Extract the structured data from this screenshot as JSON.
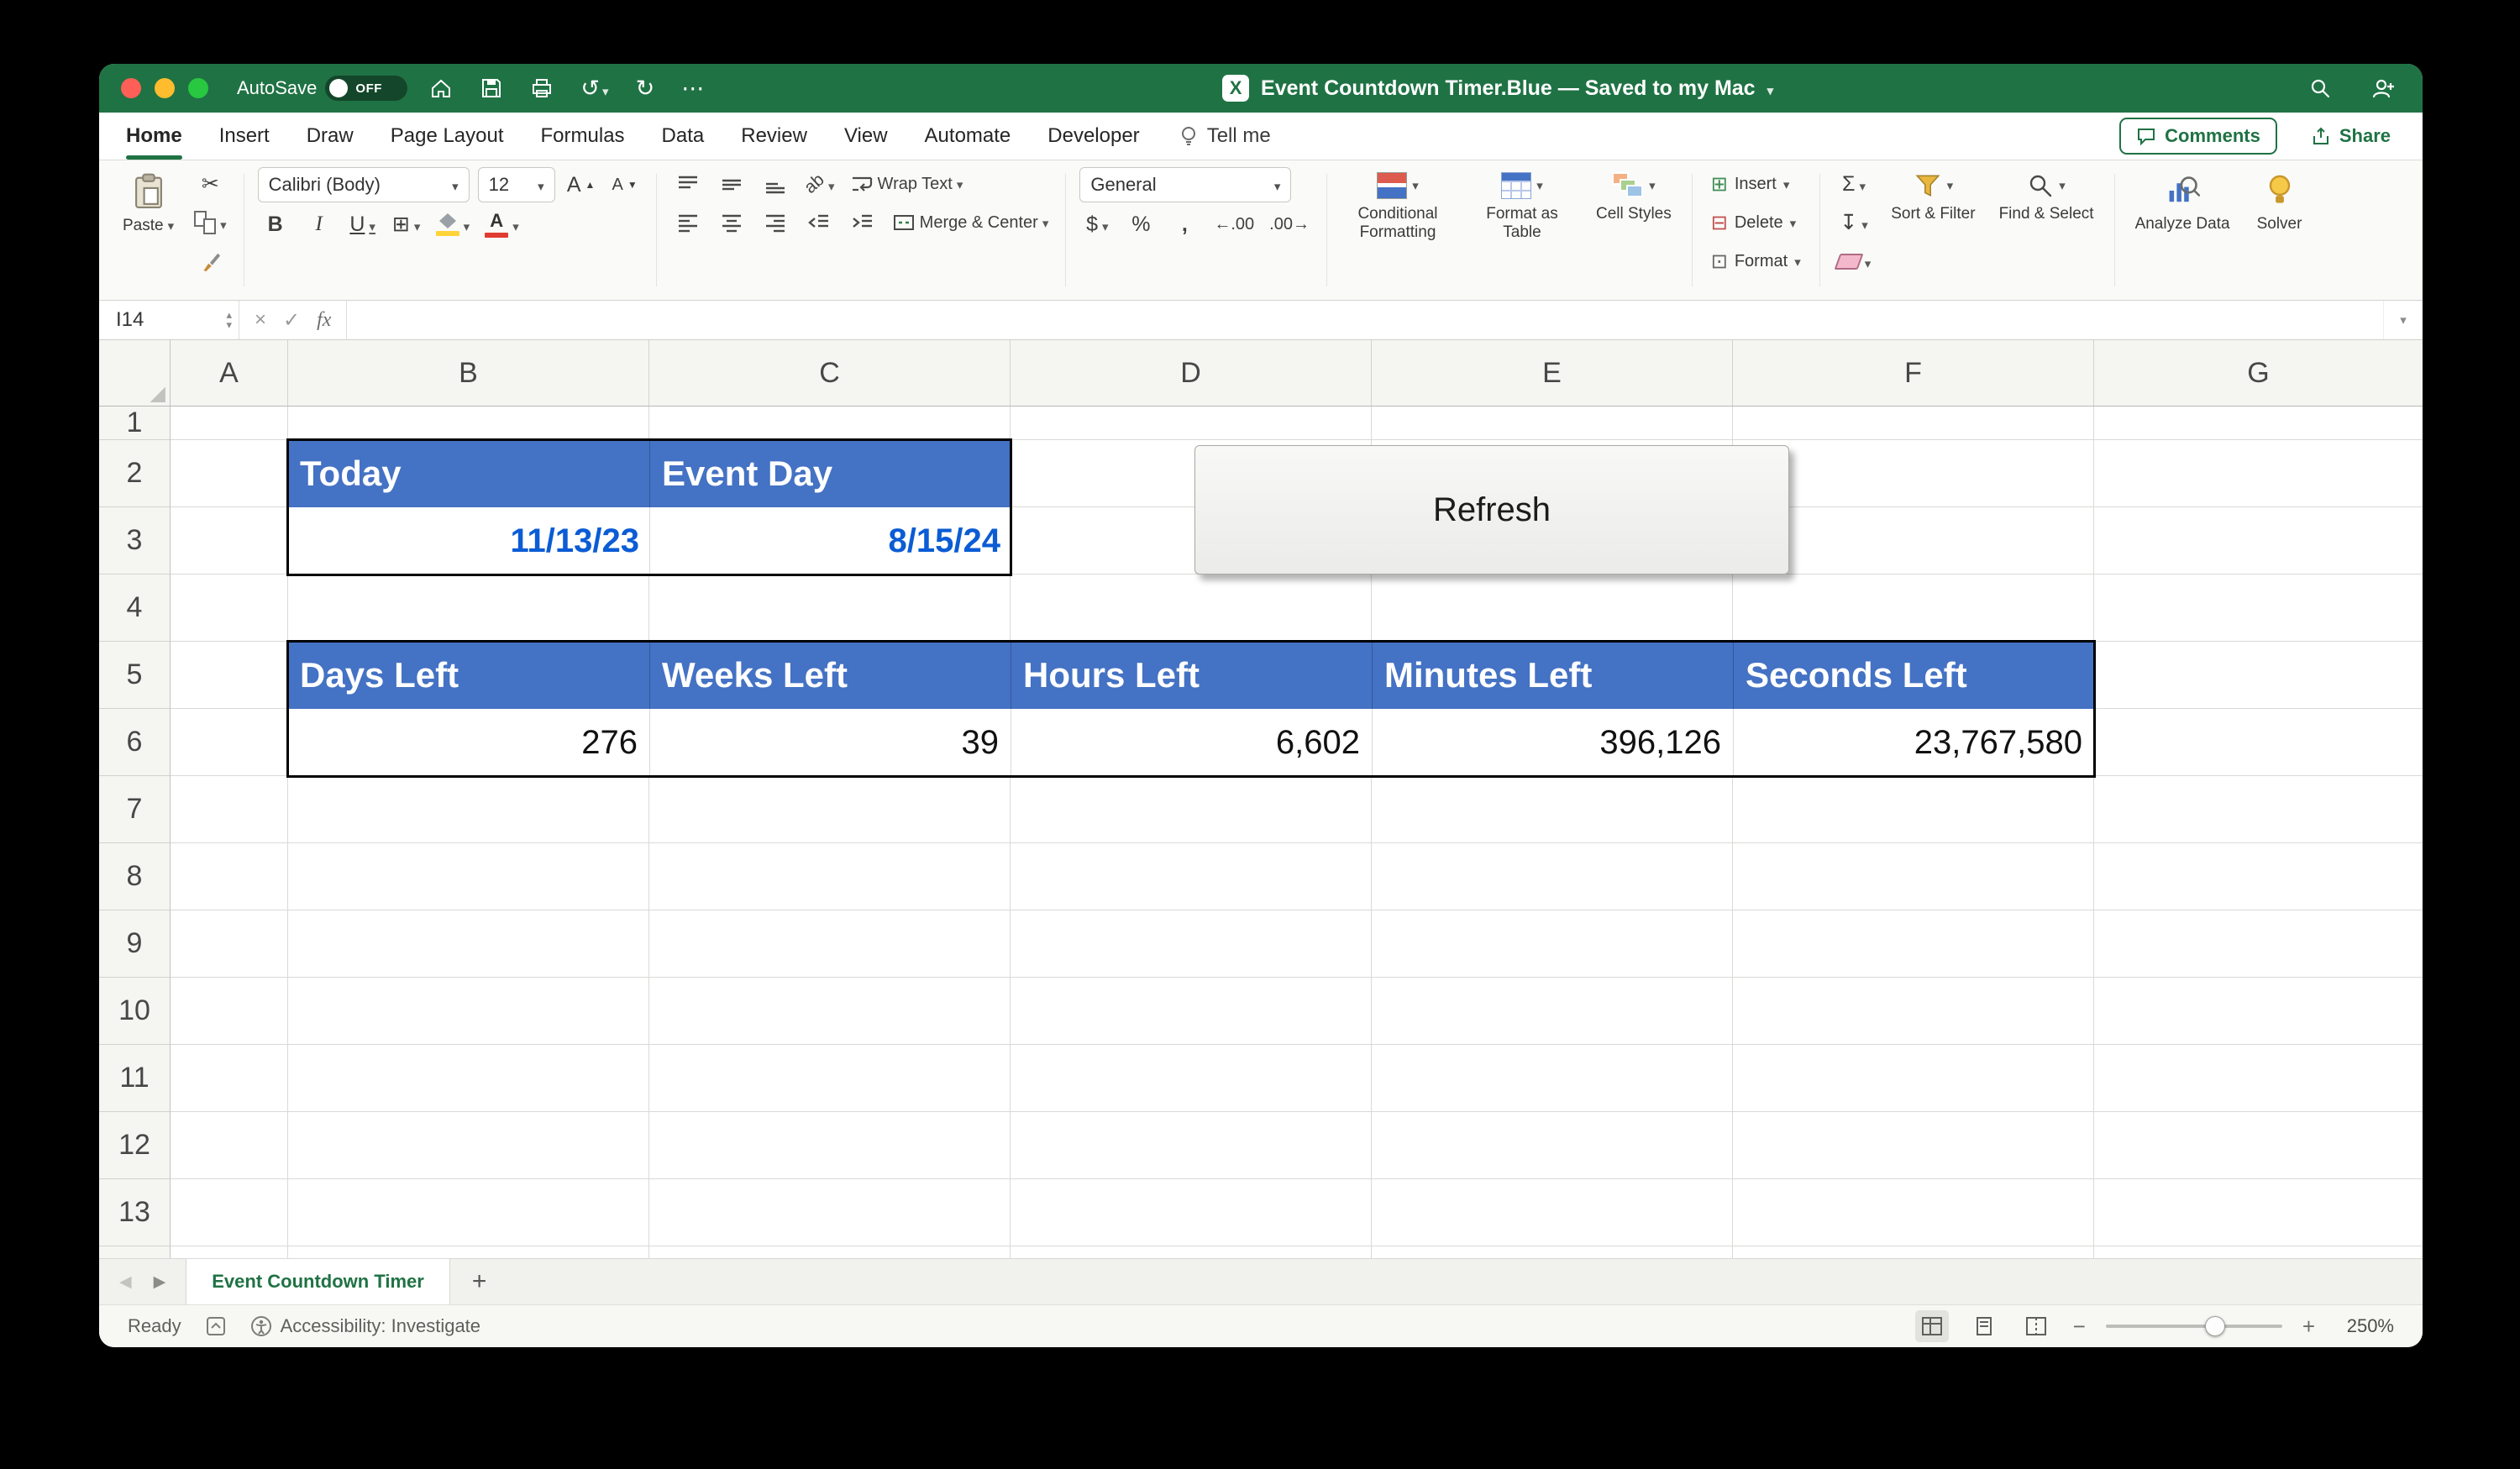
{
  "titlebar": {
    "autosave_label": "AutoSave",
    "autosave_state": "OFF",
    "title": "Event Countdown Timer.Blue — Saved to my Mac"
  },
  "ribbon_tabs": {
    "tabs": [
      "Home",
      "Insert",
      "Draw",
      "Page Layout",
      "Formulas",
      "Data",
      "Review",
      "View",
      "Automate",
      "Developer"
    ],
    "active": "Home",
    "tell_me": "Tell me",
    "comments": "Comments",
    "share": "Share"
  },
  "ribbon": {
    "paste": "Paste",
    "font_name": "Calibri (Body)",
    "font_size": "12",
    "wrap_text": "Wrap Text",
    "merge_center": "Merge & Center",
    "number_format": "General",
    "conditional_formatting": "Conditional Formatting",
    "format_as_table": "Format as Table",
    "cell_styles": "Cell Styles",
    "insert": "Insert",
    "delete": "Delete",
    "format": "Format",
    "sort_filter": "Sort & Filter",
    "find_select": "Find & Select",
    "analyze_data": "Analyze Data",
    "solver": "Solver"
  },
  "formula_bar": {
    "name_box": "I14",
    "formula": ""
  },
  "grid": {
    "columns": [
      "A",
      "B",
      "C",
      "D",
      "E",
      "F",
      "G"
    ],
    "rows": [
      "1",
      "2",
      "3",
      "4",
      "5",
      "6",
      "7",
      "8",
      "9",
      "10",
      "11",
      "12",
      "13"
    ]
  },
  "sheet": {
    "cells": {
      "today_label": "Today",
      "event_day_label": "Event Day",
      "today_date": "11/13/23",
      "event_date": "8/15/24",
      "refresh_label": "Refresh",
      "table_headers": [
        "Days Left",
        "Weeks Left",
        "Hours Left",
        "Minutes Left",
        "Seconds Left"
      ],
      "table_values": [
        "276",
        "39",
        "6,602",
        "396,126",
        "23,767,580"
      ]
    },
    "colors": {
      "header_fill": "#4472C4",
      "header_text": "#FFFFFF",
      "date_text": "#0B5CD5",
      "titlebar_green": "#1F7244"
    }
  },
  "sheet_tabs": {
    "active": "Event Countdown Timer"
  },
  "status_bar": {
    "ready": "Ready",
    "accessibility": "Accessibility: Investigate",
    "zoom": "250%"
  },
  "icons": {
    "undo": "↺",
    "redo": "↻",
    "more": "⋯",
    "cut": "✂",
    "sigma": "Σ",
    "fill_down": "↧",
    "bold": "B",
    "italic": "I",
    "underline": "U",
    "borders": "⊞",
    "font_letter": "A",
    "size_up": "▲",
    "size_down": "▼",
    "dollar": "$",
    "percent": "%",
    "comma": ",",
    "increase_decimal": "←.00",
    "decrease_decimal": ".00→",
    "cancel": "×",
    "check": "✓",
    "fx": "fx",
    "insert_cells": "⊞",
    "delete_cells": "⊟",
    "format_cells": "⊡",
    "orientation": "ab",
    "prev_sheet": "◀",
    "next_sheet": "▶",
    "add_sheet": "+",
    "zoom_out": "−",
    "zoom_in": "+",
    "spinner_up": "▴",
    "spinner_down": "▾",
    "corner_triangle": "◢"
  }
}
